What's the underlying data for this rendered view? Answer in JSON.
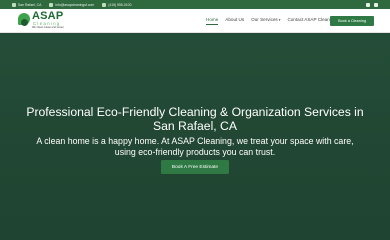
{
  "topbar": {
    "location": "San Rafael, CA",
    "email": "info@asapcleaningsf.com",
    "phone": "(415) 555-0100",
    "social": [
      "facebook-icon",
      "instagram-icon"
    ]
  },
  "brand": {
    "name": "ASAP",
    "sub": "Cleaning",
    "tagline": "We Clean Clean and Green"
  },
  "nav": {
    "items": [
      {
        "label": "Home",
        "active": true
      },
      {
        "label": "About Us",
        "active": false
      },
      {
        "label": "Our Services",
        "active": false,
        "has_dropdown": true
      },
      {
        "label": "Contact ASAP Cleaning",
        "active": false
      }
    ],
    "cta": "Book a Cleaning"
  },
  "hero": {
    "title": "Professional Eco-Friendly Cleaning & Organization Services in San Rafael, CA",
    "subtitle": "A clean home is a happy home. At ASAP Cleaning, we treat your space with care, using eco-friendly products you can trust.",
    "button": "Book A Free Estimate"
  },
  "colors": {
    "primary": "#2f7a44",
    "hero_bg": "#234a36",
    "topbar_bg": "#2f6a3f"
  }
}
